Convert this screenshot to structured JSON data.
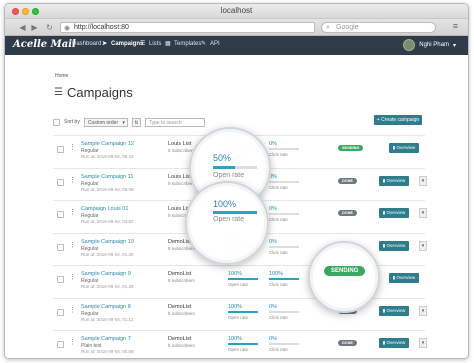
{
  "window": {
    "title": "localhost"
  },
  "browser": {
    "url": "http://localhost:80",
    "search_placeholder": "Google"
  },
  "app": {
    "logo": "Acelle Mail",
    "nav": [
      {
        "label": "Dashboard",
        "icon": "home-icon"
      },
      {
        "label": "Campaigns",
        "icon": "paper-plane-icon"
      },
      {
        "label": "Lists",
        "icon": "list-icon"
      },
      {
        "label": "Templates",
        "icon": "layout-icon"
      },
      {
        "label": "API",
        "icon": "wrench-icon"
      }
    ],
    "user": "Nghi Pham"
  },
  "page": {
    "breadcrumb": "Home",
    "title": "Campaigns",
    "sort_label": "Sort by",
    "sort_value": "Custom order",
    "search_placeholder": "Type to search",
    "create_button": "+ Create campaign"
  },
  "campaigns": [
    {
      "name": "Sample Campaign 12",
      "type": "Regular",
      "run_at": "Run at: 2016-09-04, 05:22",
      "list": "Louis List",
      "subscribers": "5 subscribers",
      "open": "0%",
      "open_fill": 0,
      "open_label": "Open rate",
      "click": "0%",
      "click_fill": 0,
      "click_label": "Click rate",
      "status": "SENDING",
      "status_kind": "sending",
      "action": "Overview",
      "dropdown": false
    },
    {
      "name": "Sample Campaign 11",
      "type": "Regular",
      "run_at": "Run at: 2016-09-04, 05:06",
      "list": "Louis List",
      "subscribers": "5 subscribers",
      "open": "50%",
      "open_fill": 0.5,
      "open_label": "Open rate",
      "click": "0%",
      "click_fill": 0,
      "click_label": "Click rate",
      "status": "DONE",
      "status_kind": "done",
      "action": "Overview",
      "dropdown": true
    },
    {
      "name": "Campaign Louis 01",
      "type": "Regular",
      "run_at": "Run at: 2016-09-04, 04:52",
      "list": "Louis List",
      "subscribers": "5 subscribers",
      "open": "100%",
      "open_fill": 1,
      "open_label": "Open rate",
      "click": "0%",
      "click_fill": 0,
      "click_label": "Click rate",
      "status": "DONE",
      "status_kind": "done",
      "action": "Overview",
      "dropdown": true
    },
    {
      "name": "Sample Campaign 10",
      "type": "Regular",
      "run_at": "Run at: 2016-09-04, 01:30",
      "list": "DemoList",
      "subscribers": "5 subscribers",
      "open": "0%",
      "open_fill": 0,
      "open_label": "Open rate",
      "click": "0%",
      "click_fill": 0,
      "click_label": "Click rate",
      "status": "DONE",
      "status_kind": "done",
      "action": "Overview",
      "dropdown": true
    },
    {
      "name": "Sample Campaign 9",
      "type": "Regular",
      "run_at": "Run at: 2016-09-04, 01:29",
      "list": "DemoList",
      "subscribers": "5 subscribers",
      "open": "100%",
      "open_fill": 1,
      "open_label": "Open rate",
      "click": "100%",
      "click_fill": 1,
      "click_label": "Click rate",
      "status": "SENDING",
      "status_kind": "sending",
      "action": "Overview",
      "dropdown": false
    },
    {
      "name": "Sample Campaign 8",
      "type": "Regular",
      "run_at": "Run at: 2016-09-04, 01:12",
      "list": "DemoList",
      "subscribers": "5 subscribers",
      "open": "100%",
      "open_fill": 1,
      "open_label": "Open rate",
      "click": "0%",
      "click_fill": 0,
      "click_label": "Click rate",
      "status": "DONE",
      "status_kind": "done",
      "action": "Overview",
      "dropdown": true
    },
    {
      "name": "Sample Campaign 7",
      "type": "Plain text",
      "run_at": "Run at: 2016-09-04, 00:58",
      "list": "DemoList",
      "subscribers": "5 subscribers",
      "open": "100%",
      "open_fill": 1,
      "open_label": "Open rate",
      "click": "0%",
      "click_fill": 0,
      "click_label": "Click rate",
      "status": "DONE",
      "status_kind": "done",
      "action": "Overview",
      "dropdown": true
    }
  ],
  "magnifiers": [
    {
      "pct": "50%",
      "fill": 0.5,
      "label": "Open rate"
    },
    {
      "pct": "100%",
      "fill": 1,
      "label": "Open rate"
    },
    {
      "status": "SENDING"
    }
  ]
}
